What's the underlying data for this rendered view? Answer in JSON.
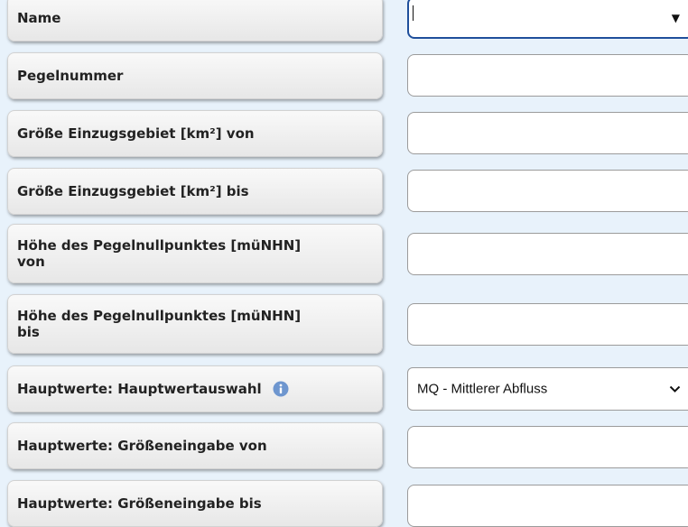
{
  "form": {
    "fields": [
      {
        "label": "Name",
        "value": ""
      },
      {
        "label": "Pegelnummer",
        "value": ""
      },
      {
        "label": "Größe Einzugsgebiet [km²] von",
        "value": ""
      },
      {
        "label": "Größe Einzugsgebiet [km²] bis",
        "value": ""
      },
      {
        "label_line1": "Höhe des Pegelnullpunktes [müNHN]",
        "label_line2": "von",
        "value": ""
      },
      {
        "label_line1": "Höhe des Pegelnullpunktes [müNHN]",
        "label_line2": "bis",
        "value": ""
      },
      {
        "label": "Hauptwerte: Hauptwertauswahl",
        "selected": "MQ - Mittlerer Abfluss"
      },
      {
        "label": "Hauptwerte: Größeneingabe von",
        "value": ""
      },
      {
        "label": "Hauptwerte: Größeneingabe bis",
        "value": ""
      }
    ]
  },
  "icons": {
    "name_dropdown": "triangle-down-icon",
    "select_chevron": "chevron-down-icon",
    "info": "info-icon"
  },
  "colors": {
    "page_background": "#e8f2fb",
    "label_background": "#eeeeee",
    "focus_border": "#1f4f9b",
    "info_icon": "#6e96cf"
  }
}
